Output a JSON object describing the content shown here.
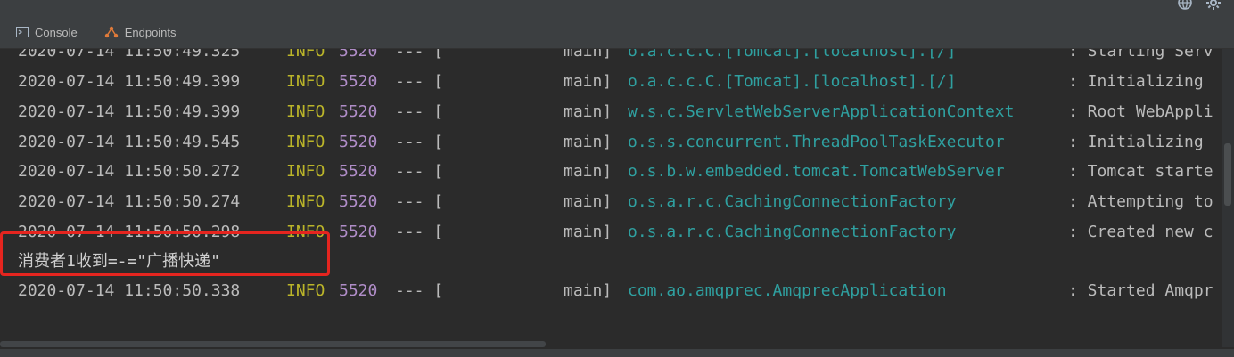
{
  "tabs": [
    {
      "label": "Console",
      "icon": "console-icon"
    },
    {
      "label": "Endpoints",
      "icon": "endpoints-icon"
    }
  ],
  "log": [
    {
      "ts": "2020-07-14 11:50:49.325",
      "level": "INFO",
      "pid": "5520",
      "sep": "--- [",
      "thread": "main]",
      "logger": "o.a.c.c.C.[Tomcat].[localhost].[/]",
      "msg": ": Starting Serv"
    },
    {
      "ts": "2020-07-14 11:50:49.399",
      "level": "INFO",
      "pid": "5520",
      "sep": "--- [",
      "thread": "main]",
      "logger": "o.a.c.c.C.[Tomcat].[localhost].[/]",
      "msg": ": Initializing"
    },
    {
      "ts": "2020-07-14 11:50:49.399",
      "level": "INFO",
      "pid": "5520",
      "sep": "--- [",
      "thread": "main]",
      "logger": "w.s.c.ServletWebServerApplicationContext",
      "msg": ": Root WebAppli"
    },
    {
      "ts": "2020-07-14 11:50:49.545",
      "level": "INFO",
      "pid": "5520",
      "sep": "--- [",
      "thread": "main]",
      "logger": "o.s.s.concurrent.ThreadPoolTaskExecutor",
      "msg": ": Initializing"
    },
    {
      "ts": "2020-07-14 11:50:50.272",
      "level": "INFO",
      "pid": "5520",
      "sep": "--- [",
      "thread": "main]",
      "logger": "o.s.b.w.embedded.tomcat.TomcatWebServer",
      "msg": ": Tomcat starte"
    },
    {
      "ts": "2020-07-14 11:50:50.274",
      "level": "INFO",
      "pid": "5520",
      "sep": "--- [",
      "thread": "main]",
      "logger": "o.s.a.r.c.CachingConnectionFactory",
      "msg": ": Attempting to"
    },
    {
      "ts": "2020-07-14 11:50:50.298",
      "level": "INFO",
      "pid": "5520",
      "sep": "--- [",
      "thread": "main]",
      "logger": "o.s.a.r.c.CachingConnectionFactory",
      "msg": ": Created new c"
    }
  ],
  "plain_line": "消费者1收到=-=\"广播快递\"",
  "last": {
    "ts": "2020-07-14 11:50:50.338",
    "level": "INFO",
    "pid": "5520",
    "sep": "--- [",
    "thread": "main]",
    "logger": "com.ao.amqprec.AmqprecApplication",
    "msg": ": Started Amqpr"
  },
  "colors": {
    "background": "#2b2b2b",
    "info": "#bbb529",
    "pid": "#b08dc8",
    "logger": "#2fa0a0",
    "highlight_box": "#e5251f"
  }
}
